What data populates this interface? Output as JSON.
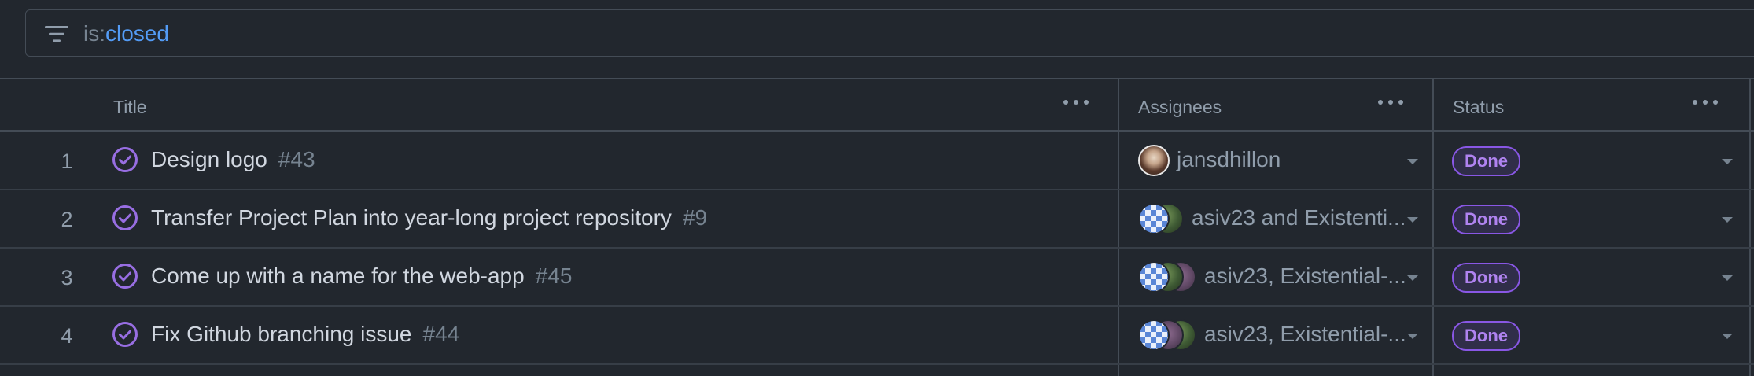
{
  "filter": {
    "key": "is:",
    "value": "closed",
    "icon": "filter-icon"
  },
  "columns": {
    "title": "Title",
    "assignees": "Assignees",
    "status": "Status"
  },
  "rows": [
    {
      "num": "1",
      "title": "Design logo",
      "ref": "#43",
      "assignees": "jansdhillon",
      "status": "Done"
    },
    {
      "num": "2",
      "title": "Transfer Project Plan into year-long project repository",
      "ref": "#9",
      "assignees": "asiv23 and Existenti...",
      "status": "Done"
    },
    {
      "num": "3",
      "title": "Come up with a name for the web-app",
      "ref": "#45",
      "assignees": "asiv23, Existential-...",
      "status": "Done"
    },
    {
      "num": "4",
      "title": "Fix Github branching issue",
      "ref": "#44",
      "assignees": "asiv23, Existential-...",
      "status": "Done"
    }
  ],
  "colors": {
    "background": "#22272e",
    "border": "#444c56",
    "closed_icon": "#986ee2",
    "done_badge": "#8957e5",
    "filter_value": "#539bf5"
  }
}
